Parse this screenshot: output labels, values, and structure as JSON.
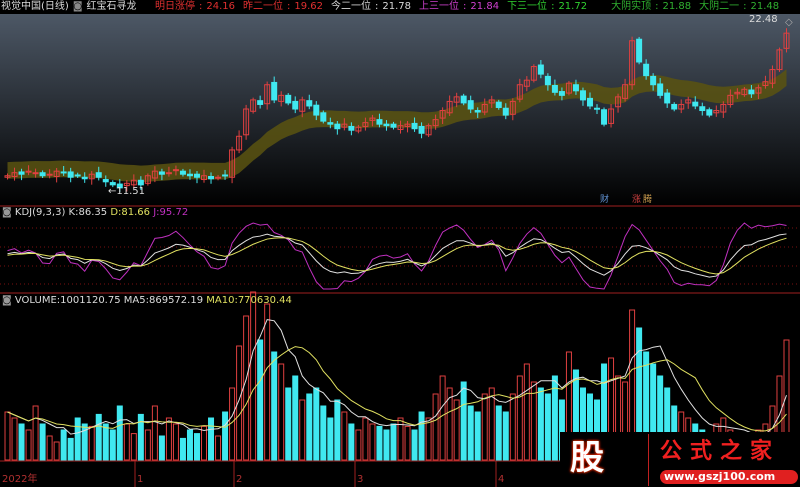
{
  "header": {
    "title": "视觉中国(日线)",
    "indicator": "红宝石寻龙",
    "items": [
      {
        "label": "明日涨停",
        "value": "24.16",
        "color": "#e03030"
      },
      {
        "label": "昨二一位",
        "value": "19.62",
        "color": "#e03030"
      },
      {
        "label": "今二一位",
        "value": "21.78",
        "color": "#d8d8d8"
      },
      {
        "label": "上三一位",
        "value": "21.84",
        "color": "#d040d0"
      },
      {
        "label": "下三一位",
        "value": "21.72",
        "color": "#30d030"
      },
      {
        "label": "大阴实顶",
        "value": "21.88",
        "color": "#30b030"
      },
      {
        "label": "大阴二一",
        "value": "21.48",
        "color": "#30b030"
      }
    ]
  },
  "price_labels": {
    "high": "22.48",
    "low": "11.51"
  },
  "markers": {
    "cai": "财",
    "zhang": "涨",
    "teng": "腾"
  },
  "kdj": {
    "title": "KDJ(9,3,3)",
    "k_label": "K:",
    "k": "86.35",
    "d_label": "D:",
    "d": "81.66",
    "j_label": "J:",
    "j": "95.72"
  },
  "volume": {
    "title": "VOLUME:",
    "value": "1001120.75",
    "ma5_label": "MA5:",
    "ma5": "869572.19",
    "ma10_label": "MA10:",
    "ma10": "770630.44"
  },
  "time_axis": [
    "2022年",
    "1",
    "2",
    "3",
    "4"
  ],
  "watermark": {
    "char": "股",
    "name": "公式之家",
    "url": "www.gszj100.com"
  },
  "colors": {
    "up": "#e04040",
    "down": "#40e8f0",
    "band": "#5a5410",
    "k": "#e0e0e0",
    "d": "#e0e060",
    "j": "#c030c0"
  },
  "chart_data": {
    "type": "candlestick",
    "closes": [
      12.6,
      12.8,
      12.7,
      12.9,
      12.8,
      12.6,
      12.7,
      12.9,
      12.8,
      12.5,
      12.6,
      12.4,
      12.7,
      12.5,
      12.2,
      12.0,
      11.8,
      12.1,
      12.3,
      12.0,
      12.6,
      12.9,
      12.7,
      12.8,
      13.0,
      12.7,
      12.6,
      12.5,
      12.6,
      12.4,
      12.5,
      12.6,
      14.3,
      15.2,
      17.0,
      17.6,
      17.3,
      18.6,
      17.6,
      17.9,
      17.4,
      17.0,
      17.6,
      17.2,
      16.6,
      16.2,
      16.0,
      15.7,
      16.0,
      15.6,
      15.8,
      16.1,
      16.4,
      16.0,
      15.9,
      15.8,
      15.9,
      16.0,
      15.7,
      15.4,
      15.9,
      16.3,
      16.9,
      17.5,
      17.8,
      17.4,
      17.0,
      16.8,
      17.3,
      17.6,
      17.1,
      16.6,
      17.5,
      18.6,
      18.9,
      19.8,
      19.3,
      18.6,
      18.1,
      17.9,
      18.7,
      18.2,
      17.6,
      17.2,
      17.0,
      16.0,
      17.0,
      17.8,
      18.6,
      21.5,
      20.1,
      19.2,
      18.6,
      17.9,
      17.4,
      17.0,
      17.3,
      17.6,
      17.2,
      16.9,
      16.6,
      16.9,
      17.3,
      17.9,
      18.1,
      18.3,
      18.0,
      18.4,
      18.8,
      19.6,
      20.9,
      22.0
    ],
    "volumes_10k": [
      40,
      35,
      30,
      25,
      45,
      30,
      20,
      15,
      25,
      18,
      35,
      30,
      28,
      38,
      30,
      25,
      45,
      30,
      22,
      38,
      25,
      45,
      20,
      35,
      30,
      18,
      25,
      22,
      28,
      35,
      20,
      40,
      60,
      95,
      120,
      140,
      100,
      130,
      90,
      80,
      60,
      70,
      50,
      55,
      60,
      45,
      35,
      50,
      40,
      30,
      25,
      35,
      30,
      28,
      25,
      30,
      35,
      28,
      25,
      40,
      35,
      55,
      70,
      60,
      50,
      65,
      45,
      40,
      55,
      60,
      45,
      40,
      55,
      70,
      80,
      65,
      60,
      55,
      70,
      50,
      90,
      75,
      60,
      55,
      50,
      80,
      85,
      70,
      65,
      125,
      110,
      90,
      80,
      70,
      60,
      45,
      40,
      35,
      30,
      25,
      20,
      30,
      35,
      25,
      20,
      15,
      18,
      25,
      30,
      45,
      70,
      100
    ],
    "price_range": [
      11.0,
      23.0
    ]
  }
}
